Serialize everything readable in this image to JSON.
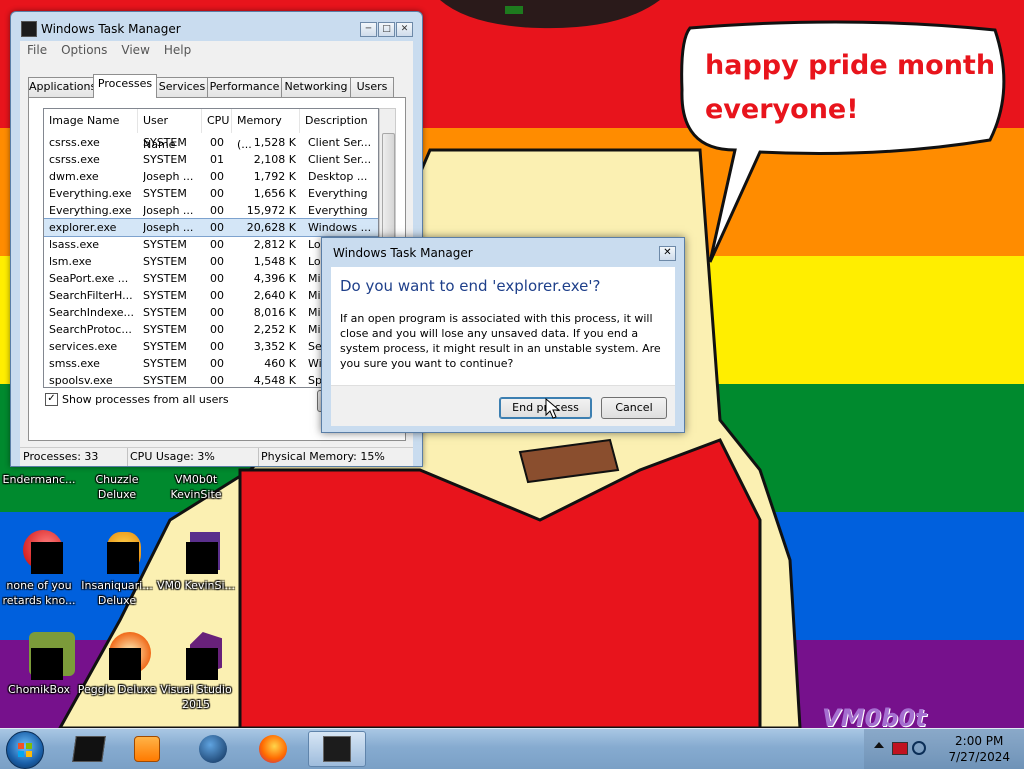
{
  "desktop": {
    "speech_bubble": [
      "happy pride month",
      "everyone!"
    ],
    "watermark": "VM0b0t",
    "icons": [
      {
        "id": "endermanc",
        "label": "Endermanc..."
      },
      {
        "id": "chuzzle",
        "label": "Chuzzle Deluxe"
      },
      {
        "id": "vm0b0t-kevinsite",
        "label": "VM0b0t KevinSite"
      },
      {
        "id": "none-of-you",
        "label": "none of you retards kno..."
      },
      {
        "id": "insaniquarium",
        "label": "Insaniquari... Deluxe"
      },
      {
        "id": "vm0-kevinsi",
        "label": "VM0 KevinSi..."
      },
      {
        "id": "chomikbox",
        "label": "ChomikBox"
      },
      {
        "id": "peggle",
        "label": "Peggle Deluxe"
      },
      {
        "id": "visual-studio",
        "label": "Visual Studio 2015"
      }
    ]
  },
  "task_manager": {
    "title": "Windows Task Manager",
    "menu": [
      "File",
      "Options",
      "View",
      "Help"
    ],
    "tabs": [
      "Applications",
      "Processes",
      "Services",
      "Performance",
      "Networking",
      "Users"
    ],
    "selected_tab": "Processes",
    "columns": [
      "Image Name",
      "User Name",
      "CPU",
      "Memory (...",
      "Description"
    ],
    "processes": [
      {
        "image": "csrss.exe",
        "user": "SYSTEM",
        "cpu": "00",
        "mem": "1,528 K",
        "desc": "Client Ser..."
      },
      {
        "image": "csrss.exe",
        "user": "SYSTEM",
        "cpu": "01",
        "mem": "2,108 K",
        "desc": "Client Ser..."
      },
      {
        "image": "dwm.exe",
        "user": "Joseph ...",
        "cpu": "00",
        "mem": "1,792 K",
        "desc": "Desktop ..."
      },
      {
        "image": "Everything.exe",
        "user": "SYSTEM",
        "cpu": "00",
        "mem": "1,656 K",
        "desc": "Everything"
      },
      {
        "image": "Everything.exe",
        "user": "Joseph ...",
        "cpu": "00",
        "mem": "15,972 K",
        "desc": "Everything"
      },
      {
        "image": "explorer.exe",
        "user": "Joseph ...",
        "cpu": "00",
        "mem": "20,628 K",
        "desc": "Windows ..."
      },
      {
        "image": "lsass.exe",
        "user": "SYSTEM",
        "cpu": "00",
        "mem": "2,812 K",
        "desc": "Local S..."
      },
      {
        "image": "lsm.exe",
        "user": "SYSTEM",
        "cpu": "00",
        "mem": "1,548 K",
        "desc": "Loc..."
      },
      {
        "image": "SeaPort.exe ...",
        "user": "SYSTEM",
        "cpu": "00",
        "mem": "4,396 K",
        "desc": "Mic..."
      },
      {
        "image": "SearchFilterH...",
        "user": "SYSTEM",
        "cpu": "00",
        "mem": "2,640 K",
        "desc": "Mic..."
      },
      {
        "image": "SearchIndexe...",
        "user": "SYSTEM",
        "cpu": "00",
        "mem": "8,016 K",
        "desc": "Mic..."
      },
      {
        "image": "SearchProtoc...",
        "user": "SYSTEM",
        "cpu": "00",
        "mem": "2,252 K",
        "desc": "Mic..."
      },
      {
        "image": "services.exe",
        "user": "SYSTEM",
        "cpu": "00",
        "mem": "3,352 K",
        "desc": "Ser..."
      },
      {
        "image": "smss.exe",
        "user": "SYSTEM",
        "cpu": "00",
        "mem": "460 K",
        "desc": "Win..."
      },
      {
        "image": "spoolsv.exe",
        "user": "SYSTEM",
        "cpu": "00",
        "mem": "4,548 K",
        "desc": "Spo..."
      }
    ],
    "selected_process": "explorer.exe",
    "show_all_label": "Show processes from all users",
    "show_all_checked": true,
    "end_button_partial": "E",
    "status": {
      "processes": "Processes: 33",
      "cpu": "CPU Usage: 3%",
      "memory": "Physical Memory: 15%"
    }
  },
  "confirm_dialog": {
    "title": "Windows Task Manager",
    "heading": "Do you want to end 'explorer.exe'?",
    "body": "If an open program is associated with this process, it will close and you will lose any unsaved data. If you end a system process, it might result in an unstable system. Are you sure you want to continue?",
    "end_label": "End process",
    "cancel_label": "Cancel"
  },
  "taskbar": {
    "time": "2:00 PM",
    "date": "7/27/2024"
  },
  "colors": {
    "red": "#e8141c",
    "orange": "#ff8c00",
    "yellow": "#ffee00",
    "green": "#008a2e",
    "blue": "#0060dd",
    "purple": "#76118c",
    "bubble_text": "#e8141c",
    "dialog_heading": "#1e3f8a"
  }
}
